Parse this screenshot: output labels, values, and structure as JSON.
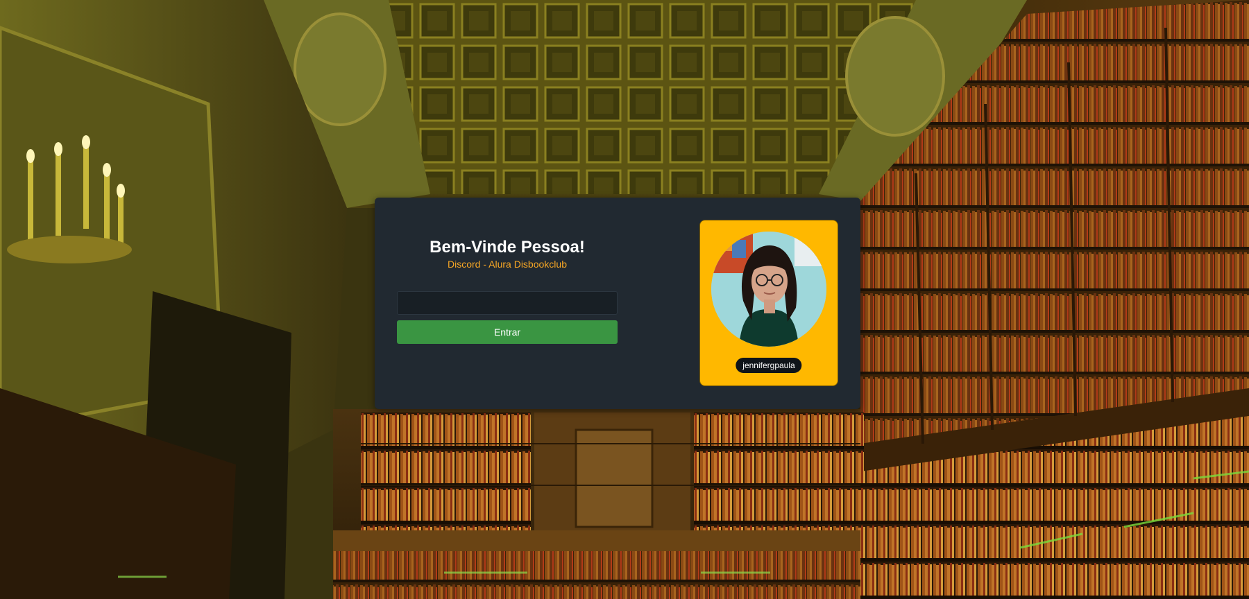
{
  "header": {
    "title": "Bem-Vinde Pessoa!",
    "subtitle": "Discord - Alura Disbookclub"
  },
  "form": {
    "username_value": "",
    "submit_label": "Entrar"
  },
  "profile": {
    "username": "jennifergpaula"
  },
  "colors": {
    "card_background": "#212931",
    "accent": "#F9A825",
    "button": "#3a9542",
    "profile_background": "#FFB800",
    "badge_background": "#0f1419"
  },
  "icons": {
    "avatar": "user-photo"
  }
}
